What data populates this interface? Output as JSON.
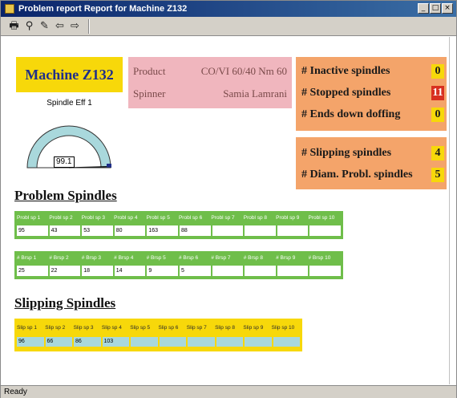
{
  "window": {
    "title": "Problem report Report for Machine Z132",
    "controls": [
      "_",
      "□",
      "×"
    ]
  },
  "toolbar": {
    "icons": [
      "printer-icon",
      "search-icon",
      "edit-icon",
      "back-arrow-icon",
      "forward-arrow-icon"
    ],
    "glyphs": [
      "🖶",
      "⚲",
      "✎",
      "⇦",
      "⇨"
    ]
  },
  "machine": {
    "name": "Machine Z132",
    "gauge_label": "Spindle Eff 1",
    "gauge_value": "99.1",
    "gauge_fraction": 0.991
  },
  "product": {
    "product_label": "Product",
    "product_value": "CO/VI 60/40  Nm 60",
    "spinner_label": "Spinner",
    "spinner_value": "Samia Lamrani"
  },
  "stats": {
    "inactive_label": "# Inactive spindles",
    "inactive_value": "0",
    "stopped_label": "# Stopped spindles",
    "stopped_value": "11",
    "ends_down_label": "# Ends down doffing",
    "ends_down_value": "0",
    "slipping_label": "# Slipping spindles",
    "slipping_value": "4",
    "diam_label": "# Diam. Probl. spindles",
    "diam_value": "5"
  },
  "problem_spindles": {
    "title": "Problem Spindles",
    "grid1": {
      "headers": [
        "Probl sp 1",
        "Probl sp 2",
        "Probl sp 3",
        "Probl sp 4",
        "Probl sp 5",
        "Probl sp 6",
        "Probl sp 7",
        "Probl sp 8",
        "Probl sp 9",
        "Probl sp 10"
      ],
      "values": [
        "95",
        "43",
        "53",
        "80",
        "163",
        "88",
        "",
        "",
        "",
        ""
      ]
    },
    "grid2": {
      "headers": [
        "# Brsp 1",
        "# Brsp 2",
        "# Brsp 3",
        "# Brsp 4",
        "# Brsp 5",
        "# Brsp 6",
        "# Brsp 7",
        "# Brsp 8",
        "# Brsp 9",
        "# Brsp 10"
      ],
      "values": [
        "25",
        "22",
        "18",
        "14",
        "9",
        "5",
        "",
        "",
        "",
        ""
      ]
    }
  },
  "slipping_spindles": {
    "title": "Slipping Spindles",
    "headers": [
      "Slip sp 1",
      "Slip sp 2",
      "Slip sp 3",
      "Slip sp 4",
      "Slip sp 5",
      "Slip sp 6",
      "Slip sp 7",
      "Slip sp 8",
      "Slip sp 9",
      "Slip sp 10"
    ],
    "values": [
      "96",
      "66",
      "86",
      "103",
      "",
      "",
      "",
      "",
      "",
      ""
    ]
  },
  "status": {
    "text": "Ready"
  },
  "colors": {
    "machine_box": "#f7d80a",
    "product_box": "#f0b6be",
    "stat_box": "#f4a46a",
    "grid_green": "#6fbe4a",
    "slip_yellow": "#f7d80a",
    "alert_red": "#d83020"
  }
}
